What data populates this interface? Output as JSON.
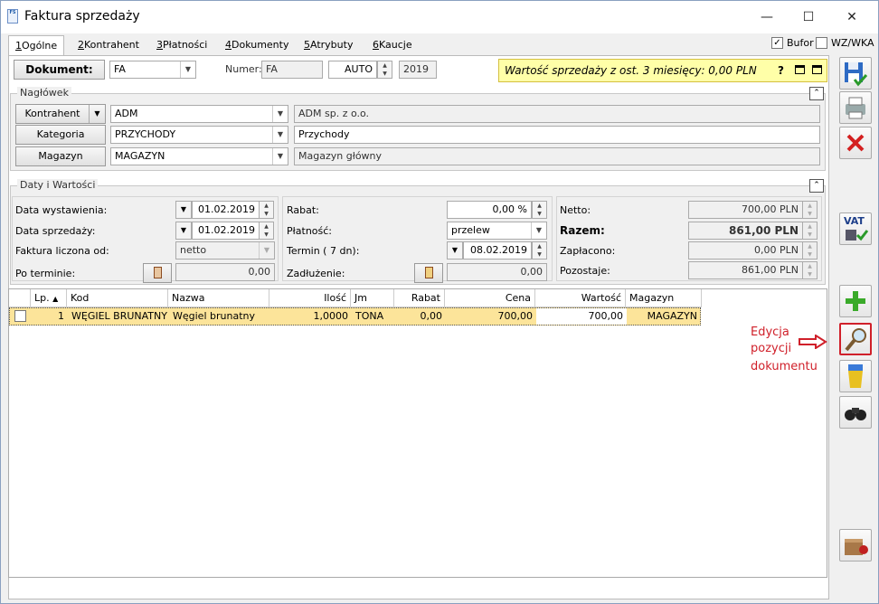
{
  "window": {
    "title": "Faktura sprzedaży",
    "icon_text": "FS",
    "min": "—",
    "max": "☐",
    "close": "✕"
  },
  "tabs": [
    {
      "num": "1",
      "label": "Ogólne"
    },
    {
      "num": "2",
      "label": "Kontrahent"
    },
    {
      "num": "3",
      "label": "Płatności"
    },
    {
      "num": "4",
      "label": "Dokumenty"
    },
    {
      "num": "5",
      "label": "Atrybuty"
    },
    {
      "num": "6",
      "label": "Kaucje"
    }
  ],
  "bufor": {
    "label": "Bufor",
    "checked": true
  },
  "wzwka": {
    "label": "WZ/WKA",
    "checked": false
  },
  "doc": {
    "button": "Dokument:",
    "type": "FA",
    "numer_label": "Numer:",
    "numer_prefix": "FA",
    "numer_auto": "AUTO",
    "numer_year": "2019"
  },
  "info": {
    "text": "Wartość sprzedaży z ost. 3 miesięcy: 0,00 PLN",
    "help": "?"
  },
  "header": {
    "title": "Nagłówek",
    "kontrahent": {
      "button": "Kontrahent",
      "code": "ADM",
      "name": "ADM sp. z o.o."
    },
    "kategoria": {
      "button": "Kategoria",
      "code": "PRZYCHODY",
      "name": "Przychody"
    },
    "magazyn": {
      "button": "Magazyn",
      "code": "MAGAZYN",
      "name": "Magazyn główny"
    }
  },
  "daty": {
    "title": "Daty i Wartości",
    "data_wyst_label": "Data wystawienia:",
    "data_wyst": "01.02.2019",
    "data_sprz_label": "Data sprzedaży:",
    "data_sprz": "01.02.2019",
    "liczona_label": "Faktura liczona od:",
    "liczona": "netto",
    "po_terminie_label": "Po terminie:",
    "po_terminie": "0,00",
    "rabat_label": "Rabat:",
    "rabat": "0,00 %",
    "platnosc_label": "Płatność:",
    "platnosc": "przelew",
    "termin_label": "Termin  (    7 dn):",
    "termin": "08.02.2019",
    "zadluzenie_label": "Zadłużenie:",
    "zadluzenie": "0,00",
    "netto_label": "Netto:",
    "netto": "700,00 PLN",
    "razem_label": "Razem:",
    "razem": "861,00 PLN",
    "zaplacono_label": "Zapłacono:",
    "zaplacono": "0,00 PLN",
    "pozostaje_label": "Pozostaje:",
    "pozostaje": "861,00 PLN"
  },
  "table": {
    "columns": [
      "Lp.",
      "Kod",
      "Nazwa",
      "Ilość",
      "Jm",
      "Rabat",
      "Cena",
      "Wartość",
      "Magazyn"
    ],
    "rows": [
      {
        "lp": "1",
        "kod": "WĘGIEL BRUNATNY",
        "nazwa": "Węgiel brunatny",
        "ilosc": "1,0000",
        "jm": "TONA",
        "rabat": "0,00",
        "cena": "700,00",
        "wartosc": "700,00",
        "magazyn": "MAGAZYN"
      }
    ]
  },
  "annotation": {
    "line1": "Edycja",
    "line2": "pozycji",
    "line3": "dokumentu",
    "color": "#d0202a"
  },
  "toolbar": {
    "vat_label": "VAT"
  }
}
